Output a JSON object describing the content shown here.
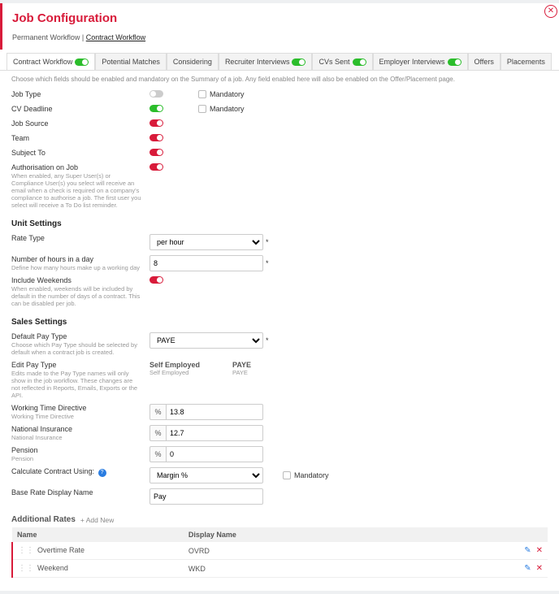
{
  "header": {
    "title": "Job Configuration",
    "breadcrumb_prefix": "Permanent Workflow",
    "breadcrumb_current": "Contract Workflow"
  },
  "tabs": [
    {
      "label": "Contract Workflow",
      "toggle": "on",
      "active": true
    },
    {
      "label": "Potential Matches",
      "toggle": null,
      "active": false
    },
    {
      "label": "Considering",
      "toggle": null,
      "active": false
    },
    {
      "label": "Recruiter Interviews",
      "toggle": "on",
      "active": false
    },
    {
      "label": "CVs Sent",
      "toggle": "on",
      "active": false
    },
    {
      "label": "Employer Interviews",
      "toggle": "on",
      "active": false
    },
    {
      "label": "Offers",
      "toggle": null,
      "active": false
    },
    {
      "label": "Placements",
      "toggle": null,
      "active": false
    }
  ],
  "intro": "Choose which fields should be enabled and mandatory on the Summary of a job. Any field enabled here will also be enabled on the Offer/Placement page.",
  "fields": {
    "jobType": {
      "label": "Job Type",
      "toggle": "off",
      "mandatory_label": "Mandatory"
    },
    "cvDeadline": {
      "label": "CV Deadline",
      "toggle": "on",
      "mandatory_label": "Mandatory"
    },
    "jobSource": {
      "label": "Job Source",
      "toggle": "red"
    },
    "team": {
      "label": "Team",
      "toggle": "red"
    },
    "subjectTo": {
      "label": "Subject To",
      "toggle": "red"
    },
    "auth": {
      "label": "Authorisation on Job",
      "sub": "When enabled, any Super User(s) or Compliance User(s) you select will receive an email when a check is required on a company's compliance to authorise a job. The first user you select will receive a To Do list reminder.",
      "toggle": "red"
    }
  },
  "unit": {
    "heading": "Unit Settings",
    "rateType": {
      "label": "Rate Type",
      "value": "per hour"
    },
    "hoursDay": {
      "label": "Number of hours in a day",
      "sub": "Define how many hours make up a working day",
      "value": "8"
    },
    "weekends": {
      "label": "Include Weekends",
      "sub": "When enabled, weekends will be included by default in the number of days of a contract. This can be disabled per job.",
      "toggle": "red"
    }
  },
  "sales": {
    "heading": "Sales Settings",
    "defaultPay": {
      "label": "Default Pay Type",
      "sub": "Choose which Pay Type should be selected by default when a contract job is created.",
      "value": "PAYE"
    },
    "editPay": {
      "label": "Edit Pay Type",
      "sub": "Edits made to the Pay Type names will only show in the job workflow. These changes are not reflected in Reports, Emails, Exports or the API.",
      "col1": {
        "h": "Self Employed",
        "s": "Self Employed"
      },
      "col2": {
        "h": "PAYE",
        "s": "PAYE"
      }
    },
    "wtd": {
      "label": "Working Time Directive",
      "sub": "Working Time Directive",
      "value": "13.8"
    },
    "ni": {
      "label": "National Insurance",
      "sub": "National Insurance",
      "value": "12.7"
    },
    "pension": {
      "label": "Pension",
      "sub": "Pension",
      "value": "0"
    },
    "calc": {
      "label": "Calculate Contract Using:",
      "value": "Margin %",
      "mandatory_label": "Mandatory"
    },
    "baseRate": {
      "label": "Base Rate Display Name",
      "value": "Pay"
    }
  },
  "rates": {
    "heading": "Additional Rates",
    "add_label": "Add New",
    "col_name": "Name",
    "col_display": "Display Name",
    "rows": [
      {
        "name": "Overtime Rate",
        "display": "OVRD"
      },
      {
        "name": "Weekend",
        "display": "WKD"
      }
    ]
  }
}
